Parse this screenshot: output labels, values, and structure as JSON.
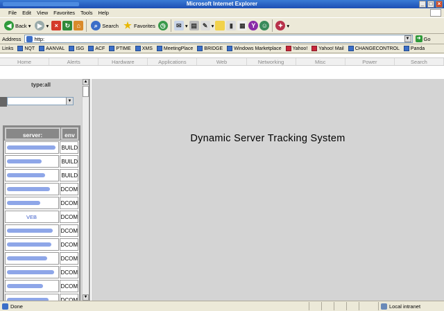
{
  "window": {
    "title": "Microsoft Internet Explorer",
    "controls": [
      "_",
      "□",
      "×"
    ]
  },
  "menu": [
    "File",
    "Edit",
    "View",
    "Favorites",
    "Tools",
    "Help"
  ],
  "toolbar": {
    "back": "Back",
    "search": "Search",
    "favorites": "Favorites"
  },
  "address": {
    "label": "Address",
    "url": "http:",
    "go": "Go"
  },
  "links": {
    "label": "Links",
    "items": [
      "NQT",
      "AANVAL",
      "ISG",
      "ACF",
      "PTIME",
      "XMS",
      "MeetingPlace",
      "BRIDGE",
      "Windows Marketplace",
      "Yahoo!",
      "Yahoo! Mail",
      "CHANGECONTROL",
      "Panda"
    ]
  },
  "nav": [
    "Home",
    "Alerts",
    "Hardware",
    "Applications",
    "Web",
    "Networking",
    "Misc",
    "Power",
    "Search"
  ],
  "sidebar": {
    "title": "type:all",
    "table": {
      "headers": [
        "server:",
        "env"
      ],
      "rows": [
        {
          "server": "",
          "env": "BUILD"
        },
        {
          "server": "",
          "env": "BUILD"
        },
        {
          "server": "",
          "env": "BUILD"
        },
        {
          "server": "",
          "env": "DCOM"
        },
        {
          "server": "",
          "env": "DCOM"
        },
        {
          "server": "VEB",
          "env": "DCOM"
        },
        {
          "server": "",
          "env": "DCOM"
        },
        {
          "server": "",
          "env": "DCOM"
        },
        {
          "server": "",
          "env": "DCOM"
        },
        {
          "server": "",
          "env": "DCOM"
        },
        {
          "server": "",
          "env": "DCOM"
        },
        {
          "server": "",
          "env": "DCOM"
        }
      ]
    }
  },
  "main": {
    "title": "Dynamic Server Tracking System"
  },
  "status": {
    "text": "Done",
    "zone": "Local intranet"
  }
}
